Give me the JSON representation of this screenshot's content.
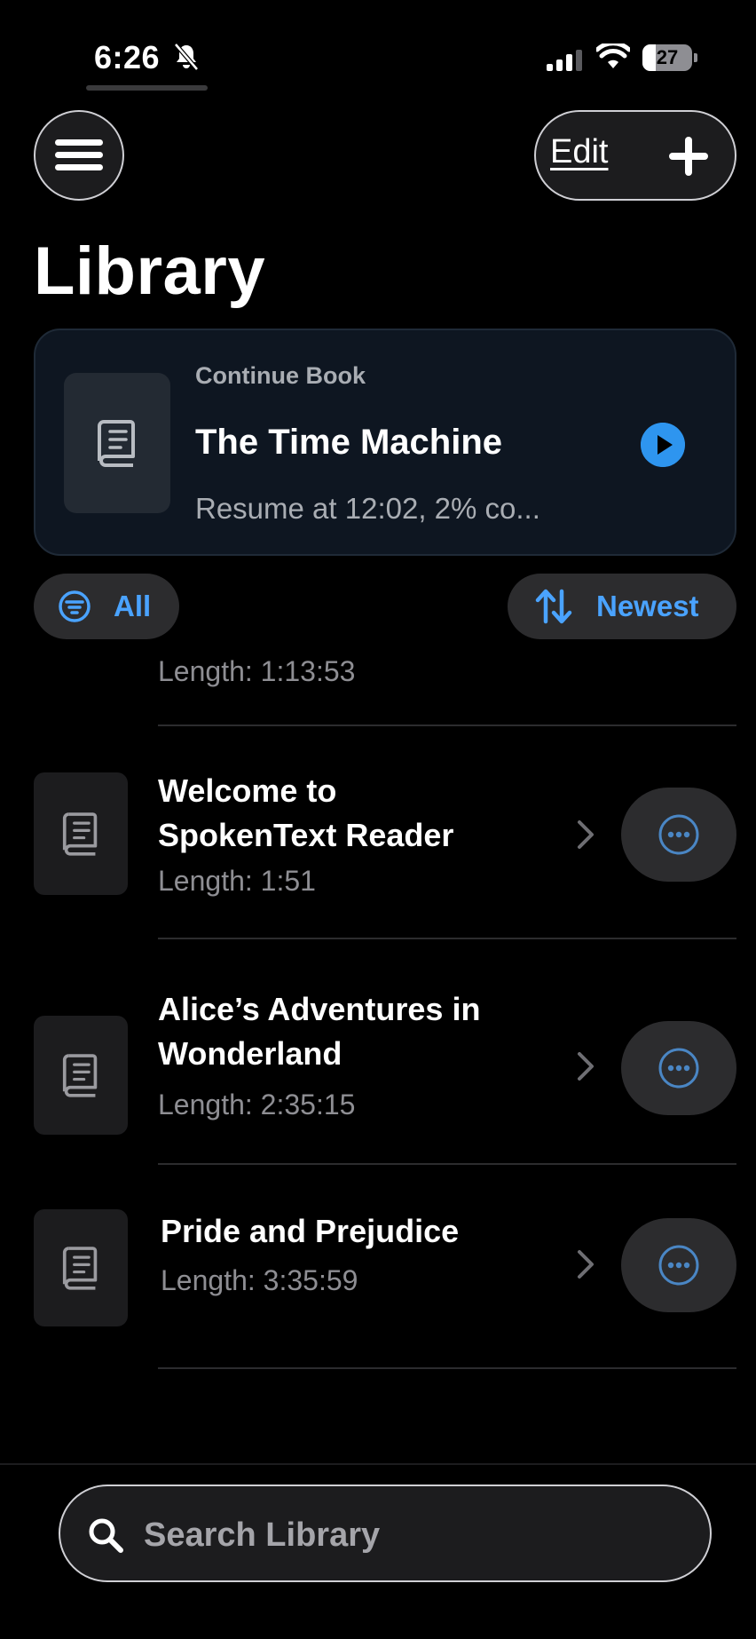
{
  "status_bar": {
    "time": "6:26",
    "battery_level": "27",
    "battery_fraction": 0.27,
    "icons": [
      "bell-slash-icon",
      "cellular-signal-icon",
      "wifi-icon",
      "battery-icon"
    ]
  },
  "header": {
    "menu_icon": "hamburger-menu-icon",
    "edit_label": "Edit",
    "add_icon": "plus-icon",
    "title": "Library"
  },
  "continue_card": {
    "kicker": "Continue Book",
    "title": "The Time Machine",
    "subtitle": "Resume at 12:02, 2% co...",
    "cover_icon": "book-icon",
    "action_icon": "play-icon"
  },
  "filters": {
    "filter_label": "All",
    "filter_icon": "filter-icon",
    "sort_label": "Newest",
    "sort_icon": "sort-arrows-icon"
  },
  "list": {
    "partial_item_length": "Length: 1:13:53",
    "books": [
      {
        "title": "Welcome to SpokenText Reader",
        "length": "Length: 1:51"
      },
      {
        "title": "Alice’s Adventures in Wonderland",
        "length": "Length: 2:35:15"
      },
      {
        "title": "Pride and Prejudice",
        "length": "Length: 3:35:59"
      }
    ]
  },
  "search": {
    "placeholder": "Search Library",
    "value": "",
    "icon": "search-icon"
  },
  "colors": {
    "accent": "#4aa3ff",
    "play": "#2e95ef",
    "card_bg": "#0e1621",
    "background": "#000000"
  }
}
